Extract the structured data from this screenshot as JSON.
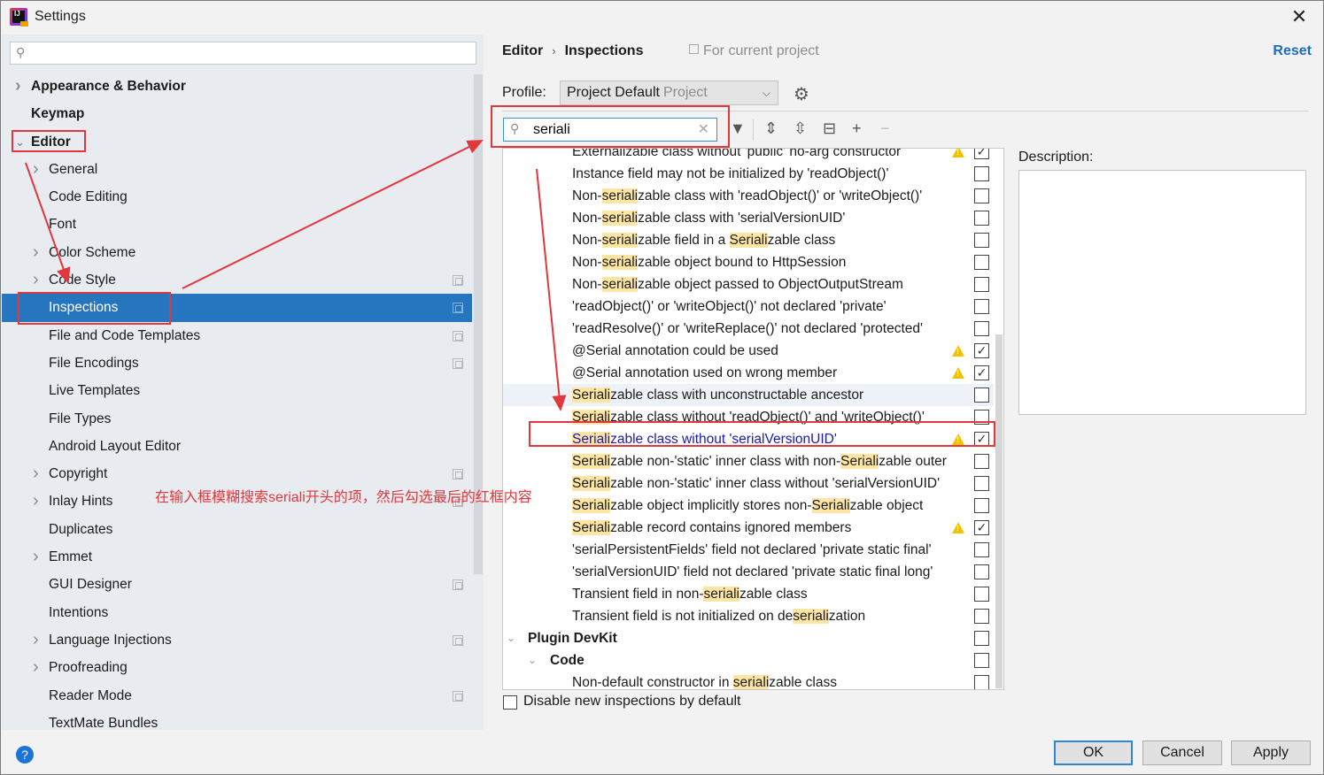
{
  "window": {
    "title": "Settings",
    "app_icon": "intellij-idea-icon",
    "close_icon": "close-icon"
  },
  "sidebar": {
    "search_placeholder": "",
    "items": [
      {
        "label": "Appearance & Behavior",
        "level": 0,
        "bold": true,
        "expandable": true,
        "expanded": false,
        "project_icon": false
      },
      {
        "label": "Keymap",
        "level": 0,
        "bold": true,
        "expandable": false,
        "project_icon": false
      },
      {
        "label": "Editor",
        "level": 0,
        "bold": true,
        "expandable": true,
        "expanded": true,
        "project_icon": false
      },
      {
        "label": "General",
        "level": 1,
        "expandable": true,
        "expanded": false,
        "project_icon": false
      },
      {
        "label": "Code Editing",
        "level": 1,
        "expandable": false,
        "project_icon": false
      },
      {
        "label": "Font",
        "level": 1,
        "expandable": false,
        "project_icon": false
      },
      {
        "label": "Color Scheme",
        "level": 1,
        "expandable": true,
        "expanded": false,
        "project_icon": false
      },
      {
        "label": "Code Style",
        "level": 1,
        "expandable": true,
        "expanded": false,
        "project_icon": true
      },
      {
        "label": "Inspections",
        "level": 1,
        "expandable": false,
        "selected": true,
        "project_icon": true
      },
      {
        "label": "File and Code Templates",
        "level": 1,
        "expandable": false,
        "project_icon": true
      },
      {
        "label": "File Encodings",
        "level": 1,
        "expandable": false,
        "project_icon": true
      },
      {
        "label": "Live Templates",
        "level": 1,
        "expandable": false,
        "project_icon": false
      },
      {
        "label": "File Types",
        "level": 1,
        "expandable": false,
        "project_icon": false
      },
      {
        "label": "Android Layout Editor",
        "level": 1,
        "expandable": false,
        "project_icon": false
      },
      {
        "label": "Copyright",
        "level": 1,
        "expandable": true,
        "expanded": false,
        "project_icon": true
      },
      {
        "label": "Inlay Hints",
        "level": 1,
        "expandable": true,
        "expanded": false,
        "project_icon": true
      },
      {
        "label": "Duplicates",
        "level": 1,
        "expandable": false,
        "project_icon": false
      },
      {
        "label": "Emmet",
        "level": 1,
        "expandable": true,
        "expanded": false,
        "project_icon": false
      },
      {
        "label": "GUI Designer",
        "level": 1,
        "expandable": false,
        "project_icon": true
      },
      {
        "label": "Intentions",
        "level": 1,
        "expandable": false,
        "project_icon": false
      },
      {
        "label": "Language Injections",
        "level": 1,
        "expandable": true,
        "expanded": false,
        "project_icon": true
      },
      {
        "label": "Proofreading",
        "level": 1,
        "expandable": true,
        "expanded": false,
        "project_icon": false
      },
      {
        "label": "Reader Mode",
        "level": 1,
        "expandable": false,
        "project_icon": true
      },
      {
        "label": "TextMate Bundles",
        "level": 1,
        "expandable": false,
        "project_icon": false
      }
    ]
  },
  "header": {
    "breadcrumb": [
      "Editor",
      "Inspections"
    ],
    "scope_label": "For current project",
    "reset_label": "Reset"
  },
  "profile": {
    "label": "Profile:",
    "value": "Project Default",
    "value_suffix": "Project"
  },
  "filter": {
    "value": "seriali",
    "placeholder": ""
  },
  "toolbar": [
    "filter-icon",
    "expand-all-icon",
    "collapse-all-icon",
    "reset-to-default-icon",
    "add-icon",
    "remove-icon"
  ],
  "inspections": {
    "highlight_term": "seriali",
    "rows": [
      {
        "text": "Externalizable class without 'public' no-arg constructor",
        "kind": "item",
        "warning": true,
        "checked": true,
        "partial": true
      },
      {
        "text": "Instance field may not be initialized by 'readObject()'",
        "kind": "item",
        "warning": false,
        "checked": false
      },
      {
        "text": "Non-serializable class with 'readObject()' or 'writeObject()'",
        "kind": "item",
        "warning": false,
        "checked": false
      },
      {
        "text": "Non-serializable class with 'serialVersionUID'",
        "kind": "item",
        "warning": false,
        "checked": false
      },
      {
        "text": "Non-serializable field in a Serializable class",
        "kind": "item",
        "warning": false,
        "checked": false
      },
      {
        "text": "Non-serializable object bound to HttpSession",
        "kind": "item",
        "warning": false,
        "checked": false
      },
      {
        "text": "Non-serializable object passed to ObjectOutputStream",
        "kind": "item",
        "warning": false,
        "checked": false
      },
      {
        "text": "'readObject()' or 'writeObject()' not declared 'private'",
        "kind": "item",
        "warning": false,
        "checked": false
      },
      {
        "text": "'readResolve()' or 'writeReplace()' not declared 'protected'",
        "kind": "item",
        "warning": false,
        "checked": false
      },
      {
        "text": "@Serial annotation could be used",
        "kind": "item",
        "warning": true,
        "checked": true
      },
      {
        "text": "@Serial annotation used on wrong member",
        "kind": "item",
        "warning": true,
        "checked": true
      },
      {
        "text": "Serializable class with unconstructable ancestor",
        "kind": "item",
        "warning": false,
        "checked": false,
        "hover": true
      },
      {
        "text": "Serializable class without 'readObject()' and 'writeObject()'",
        "kind": "item",
        "warning": false,
        "checked": false
      },
      {
        "text": "Serializable class without 'serialVersionUID'",
        "kind": "item",
        "warning": true,
        "checked": true,
        "selected": true
      },
      {
        "text": "Serializable non-'static' inner class with non-Serializable outer class",
        "kind": "item",
        "warning": false,
        "checked": false
      },
      {
        "text": "Serializable non-'static' inner class without 'serialVersionUID'",
        "kind": "item",
        "warning": false,
        "checked": false
      },
      {
        "text": "Serializable object implicitly stores non-Serializable object",
        "kind": "item",
        "warning": false,
        "checked": false
      },
      {
        "text": "Serializable record contains ignored members",
        "kind": "item",
        "warning": true,
        "checked": true
      },
      {
        "text": "'serialPersistentFields' field not declared 'private static final'",
        "kind": "item",
        "warning": false,
        "checked": false
      },
      {
        "text": "'serialVersionUID' field not declared 'private static final long'",
        "kind": "item",
        "warning": false,
        "checked": false
      },
      {
        "text": "Transient field in non-serializable class",
        "kind": "item",
        "warning": false,
        "checked": false
      },
      {
        "text": "Transient field is not initialized on deserialization",
        "kind": "item",
        "warning": false,
        "checked": false
      },
      {
        "text": "Plugin DevKit",
        "kind": "group",
        "level": 0,
        "checked": false
      },
      {
        "text": "Code",
        "kind": "group",
        "level": 1,
        "checked": false
      },
      {
        "text": "Non-default constructor in serializable class",
        "kind": "item",
        "warning": false,
        "checked": false
      }
    ]
  },
  "disable_new": {
    "label": "Disable new inspections by default",
    "checked": false
  },
  "description": {
    "label": "Description:",
    "text": ""
  },
  "buttons": {
    "ok": "OK",
    "cancel": "Cancel",
    "apply": "Apply"
  },
  "annotation": {
    "text": "在输入框模糊搜索seriali开头的项，然后勾选最后的红框内容",
    "color": "#e0383c"
  }
}
